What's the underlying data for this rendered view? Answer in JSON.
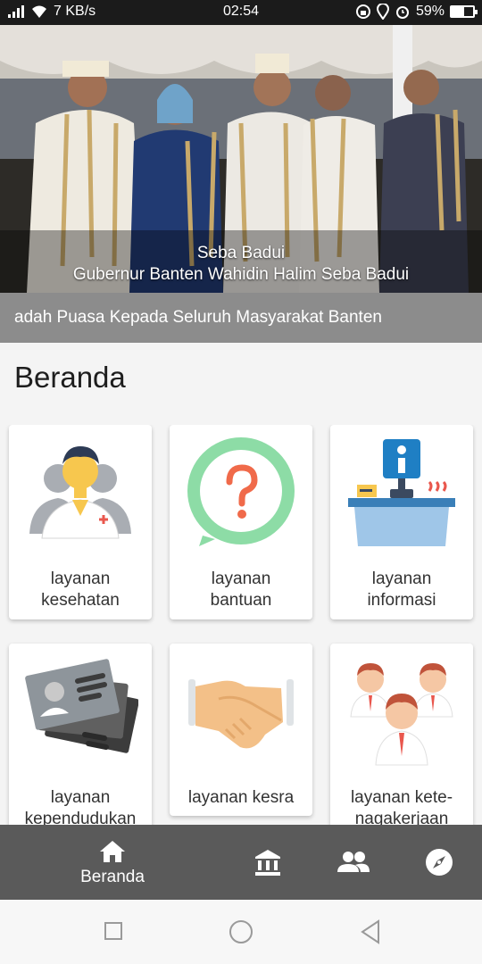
{
  "status_bar": {
    "speed": "7 KB/s",
    "time": "02:54",
    "battery_percent": "59%",
    "battery_level": 0.59
  },
  "hero": {
    "caption_line1": "Seba Badui",
    "caption_line2": "Gubernur Banten Wahidin Halim Seba Badui",
    "ticker_text": "adah Puasa Kepada Seluruh Masyarakat Banten"
  },
  "page": {
    "title": "Beranda"
  },
  "services": [
    {
      "label": "layanan\nkesehatan",
      "icon": "doctor-icon"
    },
    {
      "label": "layanan\nbantuan",
      "icon": "help-bubble-icon"
    },
    {
      "label": "layanan\ninformasi",
      "icon": "info-desk-icon"
    },
    {
      "label": "layanan\nkependudukan",
      "icon": "id-card-icon"
    },
    {
      "label": "layanan kesra",
      "icon": "handshake-icon"
    },
    {
      "label": "layanan kete-\nnagakerjaan",
      "icon": "workers-icon"
    }
  ],
  "bottom_nav": {
    "home_label": "Beranda",
    "items": [
      "home-icon",
      "institution-icon",
      "people-icon",
      "compass-icon"
    ]
  },
  "colors": {
    "nav_bg": "#5a5a5a",
    "ticker_bg": "#8c8c8c",
    "help_green": "#8ddca6",
    "help_orange": "#f06a4a",
    "info_blue": "#1f7fc4",
    "nurse_red": "#e9574d"
  }
}
